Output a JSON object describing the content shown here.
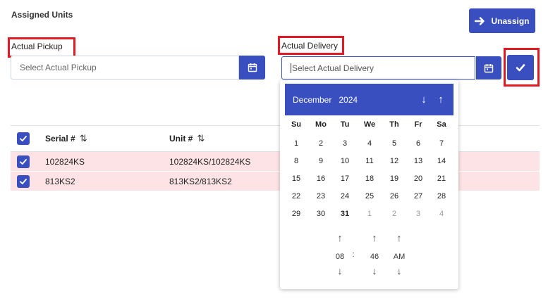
{
  "page": {
    "title": "Assigned Units",
    "unassign_label": "Unassign"
  },
  "pickup": {
    "label": "Actual Pickup",
    "placeholder": "Select Actual Pickup"
  },
  "delivery": {
    "label": "Actual Delivery",
    "placeholder": "Select Actual Delivery"
  },
  "table": {
    "headers": [
      "Serial #",
      "Unit #"
    ],
    "rows": [
      {
        "serial": "102824KS",
        "unit": "102824KS/102824KS"
      },
      {
        "serial": "813KS2",
        "unit": "813KS2/813KS2"
      }
    ]
  },
  "datepicker": {
    "month": "December",
    "year": "2024",
    "weekdays": [
      "Su",
      "Mo",
      "Tu",
      "We",
      "Th",
      "Fr",
      "Sa"
    ],
    "weeks": [
      [
        "1",
        "2",
        "3",
        "4",
        "5",
        "6",
        "7"
      ],
      [
        "8",
        "9",
        "10",
        "11",
        "12",
        "13",
        "14"
      ],
      [
        "15",
        "16",
        "17",
        "18",
        "19",
        "20",
        "21"
      ],
      [
        "22",
        "23",
        "24",
        "25",
        "26",
        "27",
        "28"
      ],
      [
        "29",
        "30",
        "31",
        "1",
        "2",
        "3",
        "4"
      ]
    ],
    "today": "31",
    "time": {
      "hour": "08",
      "separator": ":",
      "minute": "46",
      "ampm": "AM"
    }
  },
  "colors": {
    "primary": "#3a4fbf",
    "highlight": "#e01b24",
    "row_selected": "#fde3e6"
  }
}
